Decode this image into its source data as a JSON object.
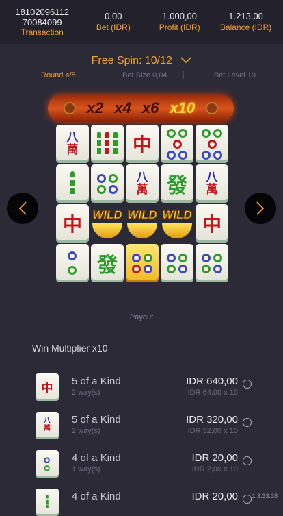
{
  "header": {
    "transaction_id_line1": "18102096112",
    "transaction_id_line2": "70084099",
    "transaction_label": "Transaction",
    "bet_value": "0,00",
    "bet_label": "Bet (IDR)",
    "profit_value": "1.000,00",
    "profit_label": "Profit (IDR)",
    "balance_value": "1.213,00",
    "balance_label": "Balance (IDR)"
  },
  "spin": {
    "title": "Free Spin: 10/12",
    "round": "Round 4/5",
    "bet_size": "Bet Size 0,04",
    "bet_level": "Bet Level 10"
  },
  "multipliers": [
    "x2",
    "x4",
    "x6",
    "x10"
  ],
  "active_multiplier": "x10",
  "reels": {
    "wild_label": "WILD",
    "tiles": [
      [
        "wan",
        "bamboo-r",
        "zhong",
        "dots5",
        "dots5"
      ],
      [
        "bamboo2",
        "dots4",
        "wan",
        "fa",
        "wan"
      ],
      [
        "zhong",
        "wild",
        "wild",
        "wild",
        "zhong"
      ],
      [
        "dots2",
        "fa",
        "gold",
        "dots4",
        "dots4"
      ]
    ]
  },
  "payout_label": "Payout",
  "win_multiplier": "Win Multiplier x10",
  "wins": [
    {
      "symbol": "zhong",
      "kind": "5 of a Kind",
      "ways": "2 way(s)",
      "amount": "IDR 640,00",
      "calc": "IDR 64,00 x 10"
    },
    {
      "symbol": "wan",
      "kind": "5 of a Kind",
      "ways": "2 way(s)",
      "amount": "IDR 320,00",
      "calc": "IDR 32,00 x 10"
    },
    {
      "symbol": "dots2",
      "kind": "4 of a Kind",
      "ways": "1 way(s)",
      "amount": "IDR 20,00",
      "calc": "IDR 2,00 x 10"
    },
    {
      "symbol": "bamboo2",
      "kind": "4 of a Kind",
      "ways": "",
      "amount": "IDR 20,00",
      "calc": ""
    }
  ],
  "version": "1.3.33.38",
  "colors": {
    "accent": "#f2a02c",
    "background": "#2b2a36",
    "header_bg": "#23222c"
  }
}
